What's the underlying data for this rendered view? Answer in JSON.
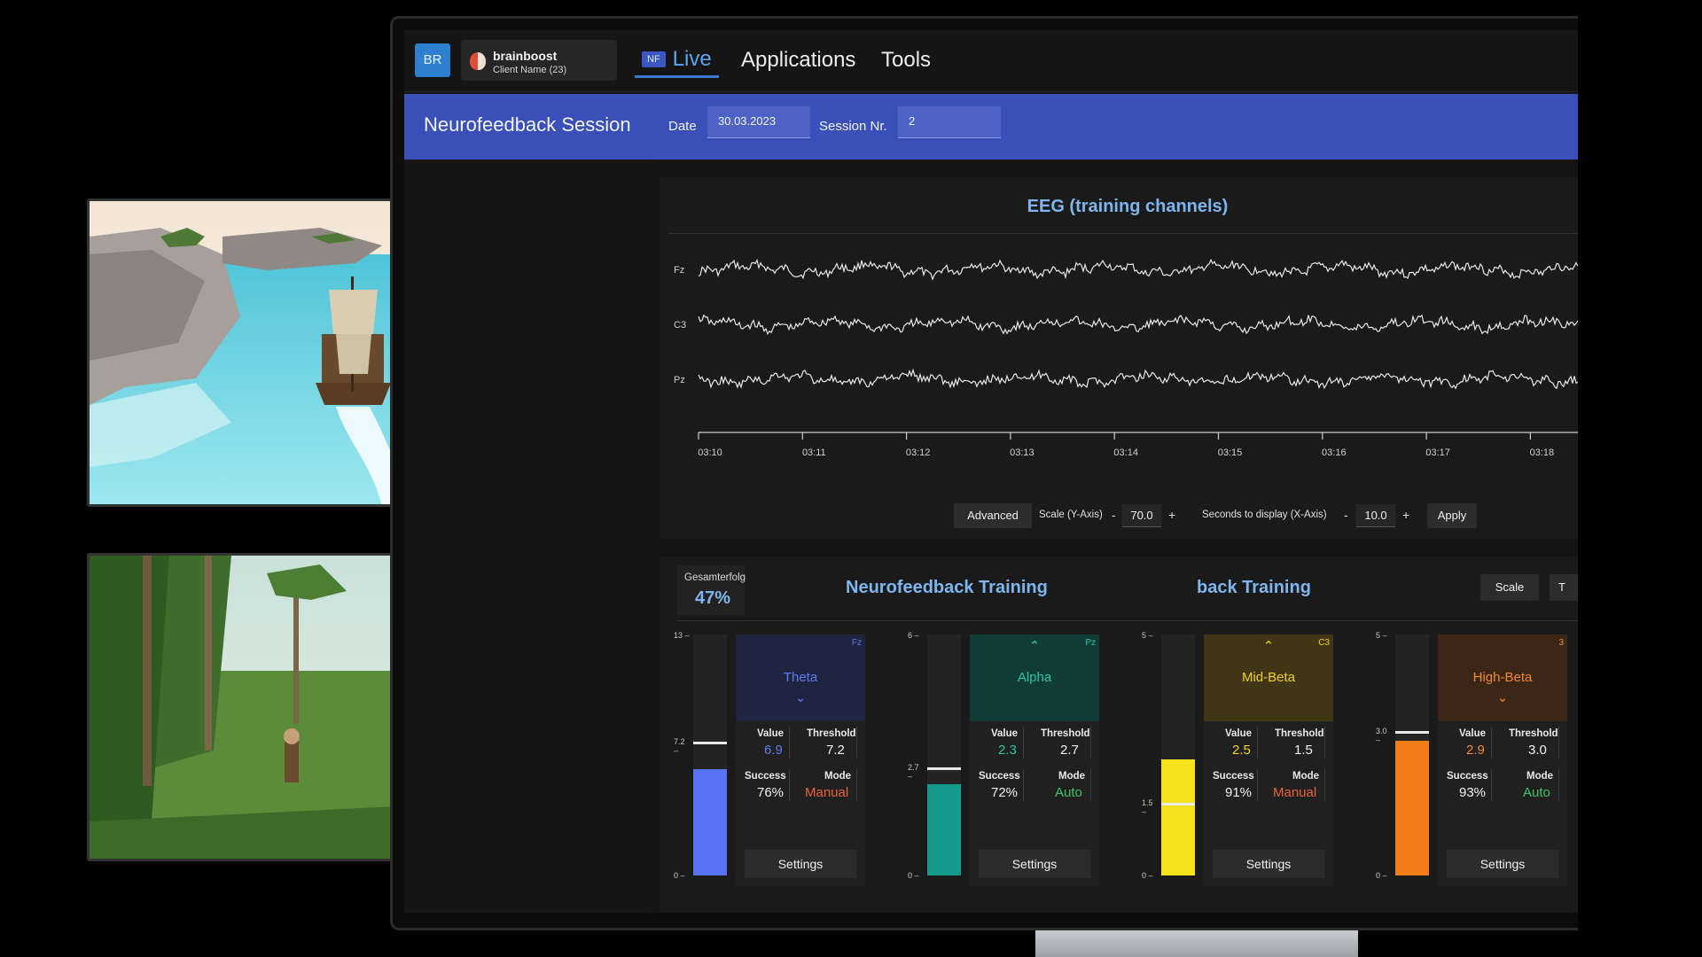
{
  "app": {
    "logo": "BR",
    "client_name": "brainboost",
    "client_sub": "Client Name (23)"
  },
  "nav": {
    "live_badge": "NF",
    "live_label": "Live",
    "applications": "Applications",
    "tools": "Tools"
  },
  "session": {
    "title": "Neurofeedback Session",
    "date_label": "Date",
    "date_value": "30.03.2023",
    "nr_label": "Session Nr.",
    "nr_value": "2"
  },
  "eeg": {
    "title": "EEG (training channels)",
    "channels": [
      "Fz",
      "C3",
      "Pz"
    ],
    "time_ticks": [
      "03:10",
      "03:11",
      "03:12",
      "03:13",
      "03:14",
      "03:15",
      "03:16",
      "03:17",
      "03:18"
    ],
    "advanced_label": "Advanced",
    "scale_label": "Scale (Y-Axis)",
    "scale_value": "70.0",
    "seconds_label": "Seconds to display (X-Axis)",
    "seconds_value": "10.0",
    "minus": "-",
    "plus": "+",
    "apply_label": "Apply"
  },
  "training": {
    "overall_label": "Gesamterfolg",
    "overall_value": "47%",
    "title": "Neurofeedback Training",
    "title2": "back Training",
    "scale_label": "Scale",
    "t_label": "T",
    "bands": [
      {
        "name": "Theta",
        "channel": "Fz",
        "arrow": "down",
        "value": "6.9",
        "threshold": "7.2",
        "success": "76%",
        "mode": "Manual",
        "axis_top": "13",
        "axis_thr": "7.2",
        "axis_bottom": "0",
        "fill_fraction": 0.44,
        "thr_fraction": 0.554,
        "color": "#5a72f5",
        "head_bg": "#1f2440",
        "name_color": "#5b7cf0",
        "value_color": "#5b7cf0",
        "mode_color": "#e8623a",
        "settings": "Settings"
      },
      {
        "name": "Alpha",
        "channel": "Pz",
        "arrow": "up",
        "value": "2.3",
        "threshold": "2.7",
        "success": "72%",
        "mode": "Auto",
        "axis_top": "6",
        "axis_thr": "2.7",
        "axis_bottom": "0",
        "fill_fraction": 0.38,
        "thr_fraction": 0.45,
        "color": "#14998a",
        "head_bg": "#113b37",
        "name_color": "#28c7a8",
        "value_color": "#28c7a8",
        "mode_color": "#3cc36a",
        "settings": "Settings"
      },
      {
        "name": "Mid-Beta",
        "channel": "C3",
        "arrow": "up",
        "value": "2.5",
        "threshold": "1.5",
        "success": "91%",
        "mode": "Manual",
        "axis_top": "5",
        "axis_thr": "1.5",
        "axis_bottom": "0",
        "fill_fraction": 0.48,
        "thr_fraction": 0.3,
        "color": "#f4e21d",
        "head_bg": "#403616",
        "name_color": "#f0d21d",
        "value_color": "#f0d21d",
        "mode_color": "#e8623a",
        "settings": "Settings"
      },
      {
        "name": "High-Beta",
        "channel": "3",
        "arrow": "down",
        "value": "2.9",
        "threshold": "3.0",
        "success": "93%",
        "mode": "Auto",
        "axis_top": "5",
        "axis_thr": "3.0",
        "axis_bottom": "0",
        "fill_fraction": 0.56,
        "thr_fraction": 0.6,
        "color": "#f37c18",
        "head_bg": "#3b2618",
        "name_color": "#f08a2a",
        "value_color": "#f08a2a",
        "mode_color": "#3cc36a",
        "settings": "Settings"
      }
    ],
    "labels": {
      "value": "Value",
      "threshold": "Threshold",
      "success": "Success",
      "mode": "Mode"
    }
  }
}
